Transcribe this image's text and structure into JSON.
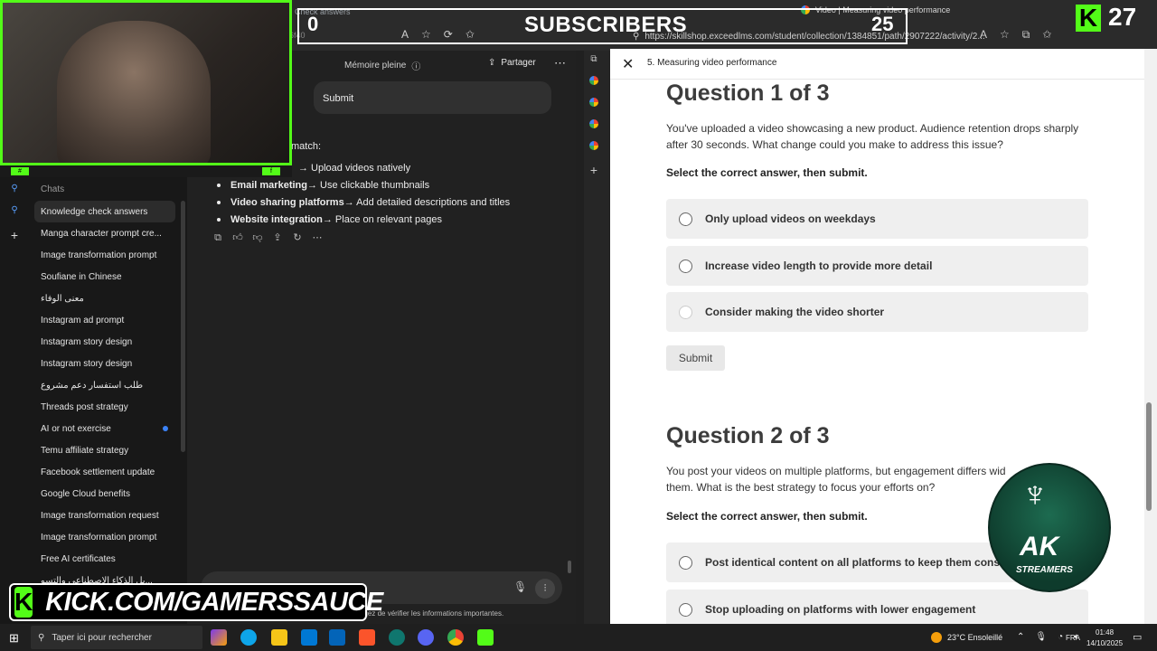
{
  "browser": {
    "left_tab_title": "Check answers",
    "right_tab_title": "Video | Measuring video performance",
    "url": "https://skillshop.exceedlms.com/student/collection/1384851/path/2907222/activity/2...",
    "left_url_fragment": "6f40"
  },
  "overlay": {
    "subscriber_title": "SUBSCRIBERS",
    "subscriber_start": "0",
    "subscriber_goal": "25",
    "kick_count": "27",
    "kick_url": "KICK.COM/GAMERSSAUCE",
    "ak_logo_text": "AK",
    "ak_logo_subtext": "STREAMERS"
  },
  "chat_app": {
    "header_memory": "Mémoire pleine",
    "share_label": "Partager",
    "user_message": "Submit",
    "answer_intro": "match:",
    "bullets": [
      {
        "bold": "",
        "text": "→ Upload videos natively"
      },
      {
        "bold": "Email marketing",
        "text": " → Use clickable thumbnails"
      },
      {
        "bold": "Video sharing platforms",
        "text": " → Add detailed descriptions and titles"
      },
      {
        "bold": "Website integration",
        "text": " → Place on relevant pages"
      }
    ],
    "disclaimer": "agez de vérifier les informations importantes.",
    "sidebar_heading": "Chats",
    "chats": [
      {
        "label": "Knowledge check answers",
        "active": true
      },
      {
        "label": "Manga character prompt cre..."
      },
      {
        "label": "Image transformation prompt"
      },
      {
        "label": "Soufiane in Chinese"
      },
      {
        "label": "معنى الوفاء",
        "rtl": true
      },
      {
        "label": "Instagram ad prompt"
      },
      {
        "label": "Instagram story design"
      },
      {
        "label": "Instagram story design"
      },
      {
        "label": "طلب استفسار دعم مشروع",
        "rtl": true
      },
      {
        "label": "Threads post strategy"
      },
      {
        "label": "AI or not exercise",
        "unread": true
      },
      {
        "label": "Temu affiliate strategy"
      },
      {
        "label": "Facebook settlement update"
      },
      {
        "label": "Google Cloud benefits"
      },
      {
        "label": "Image transformation request"
      },
      {
        "label": "Image transformation prompt"
      },
      {
        "label": "Free AI certificates"
      },
      {
        "label": "...يل الذكاء الاصطناعي والتسو",
        "rtl": true
      }
    ]
  },
  "course": {
    "breadcrumb": "5. Measuring video performance",
    "q1": {
      "title": "Question 1 of 3",
      "text": "You've uploaded a video showcasing a new product. Audience retention drops sharply after 30 seconds. What change could you make to address this issue?",
      "instruction": "Select the correct answer, then submit.",
      "options": [
        "Only upload videos on weekdays",
        "Increase video length to provide more detail",
        "Consider making the video shorter"
      ],
      "submit": "Submit"
    },
    "q2": {
      "title": "Question 2 of 3",
      "text": "You post your videos on multiple platforms, but engagement differs wid them. What is the best strategy to focus your efforts on?",
      "instruction": "Select the correct answer, then submit.",
      "options": [
        "Post identical content on all platforms to keep them consiste",
        "Stop uploading on platforms with lower engagement"
      ]
    }
  },
  "taskbar": {
    "search_placeholder": "Taper ici pour rechercher",
    "weather": "23°C  Ensoleillé",
    "language": "FRA",
    "time": "01:48",
    "date": "14/10/2025"
  },
  "colors": {
    "kick_green": "#53fc18",
    "page_bg": "#ffffff",
    "chat_bg": "#212121"
  }
}
